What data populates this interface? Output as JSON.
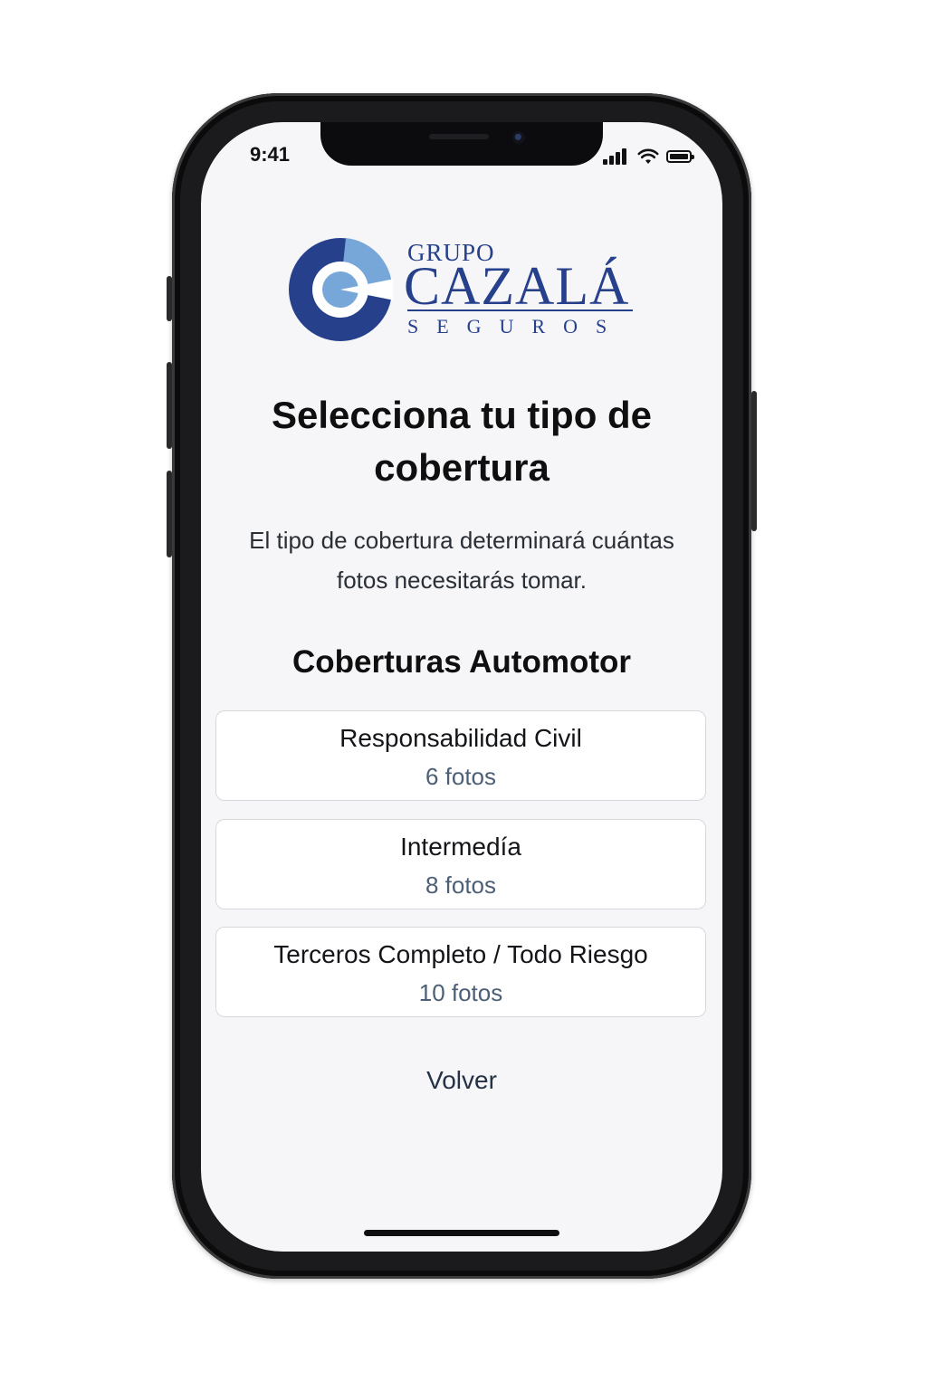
{
  "status_bar": {
    "time": "9:41",
    "icons": [
      "cellular-signal-icon",
      "wifi-icon",
      "battery-icon"
    ]
  },
  "logo": {
    "grupo": "GRUPO",
    "name": "CAZALÁ",
    "tagline": "SEGUROS",
    "colors": {
      "primary": "#26408c",
      "secondary": "#77a6d8"
    }
  },
  "page": {
    "title_line1": "Selecciona tu tipo de",
    "title_line2": "cobertura",
    "subtitle_line1": "El tipo de cobertura determinará cuántas",
    "subtitle_line2": "fotos necesitarás tomar.",
    "section_title": "Coberturas Automotor"
  },
  "coverages": [
    {
      "name": "Responsabilidad Civil",
      "photos": "6 fotos"
    },
    {
      "name": "Intermedía",
      "photos": "8 fotos"
    },
    {
      "name": "Terceros Completo / Todo Riesgo",
      "photos": "10 fotos"
    }
  ],
  "actions": {
    "back_label": "Volver"
  },
  "colors": {
    "background": "#f6f6f8",
    "card": "#ffffff",
    "muted_text": "#4d5f76"
  }
}
